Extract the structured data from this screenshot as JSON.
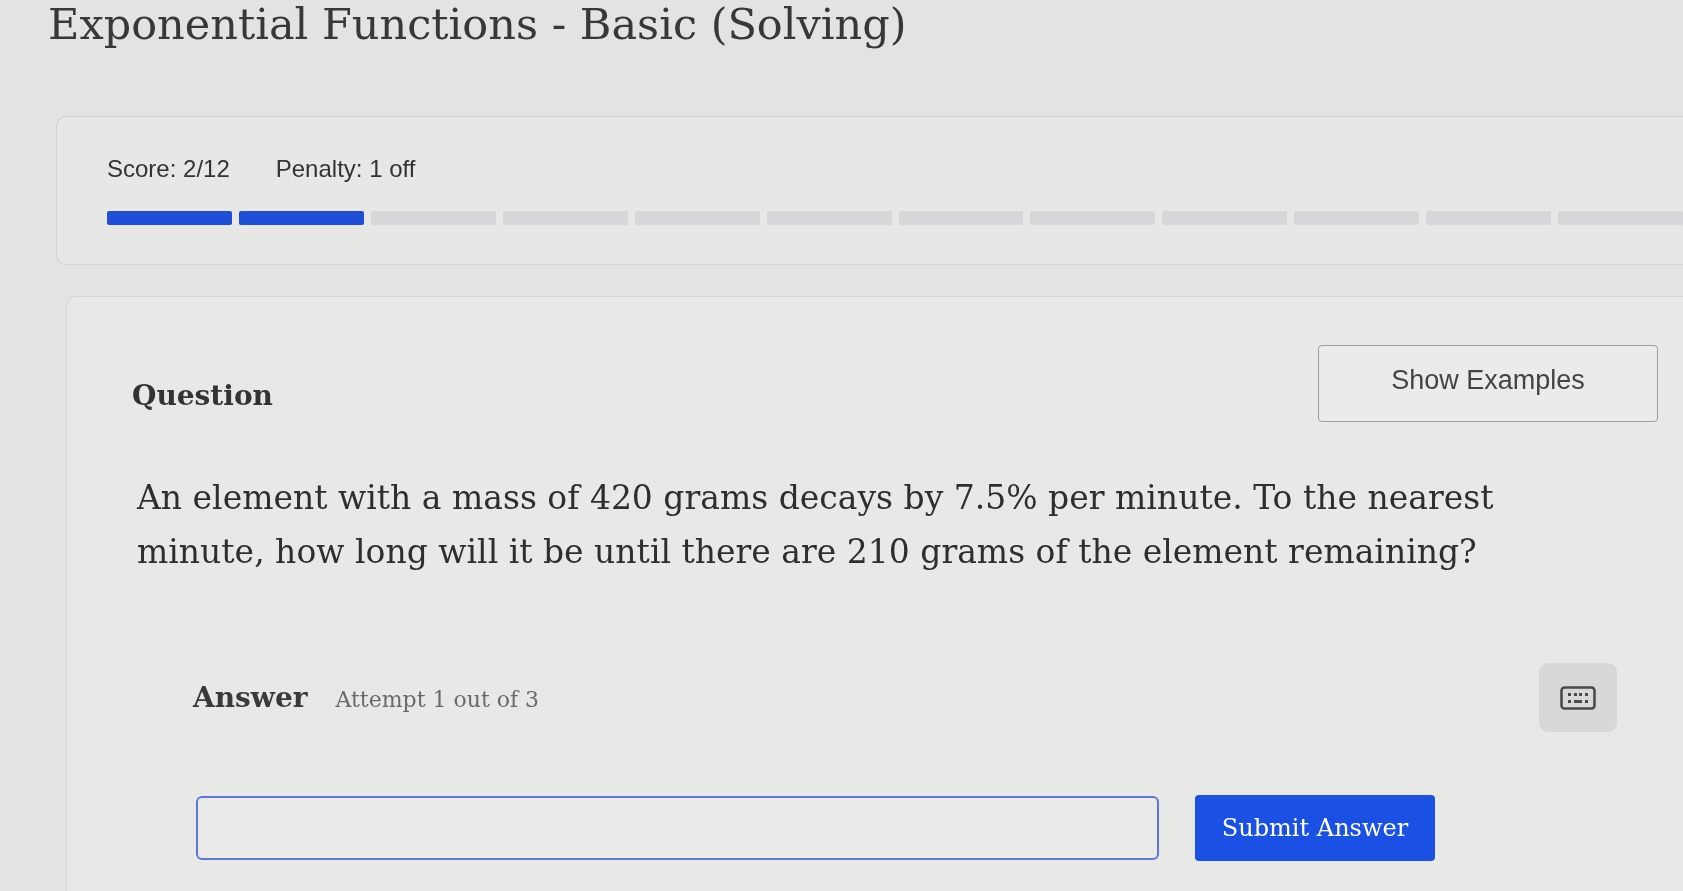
{
  "page": {
    "title": "Exponential Functions - Basic (Solving)"
  },
  "score_panel": {
    "score": "Score: 2/12",
    "penalty": "Penalty: 1 off",
    "progress": [
      {
        "filled": true
      },
      {
        "filled": true
      },
      {
        "filled": false
      },
      {
        "filled": false
      },
      {
        "filled": false
      },
      {
        "filled": false
      },
      {
        "filled": false
      },
      {
        "filled": false
      },
      {
        "filled": false
      },
      {
        "filled": false
      },
      {
        "filled": false
      },
      {
        "filled": false
      }
    ]
  },
  "question": {
    "heading": "Question",
    "show_examples_button": "Show Examples",
    "text": "An element with a mass of 420 grams decays by 7.5% per minute. To the nearest minute, how long will it be until there are 210 grams of the element remaining?"
  },
  "answer": {
    "heading": "Answer",
    "attempt": "Attempt 1 out of 3",
    "submit_button": "Submit Answer"
  }
}
